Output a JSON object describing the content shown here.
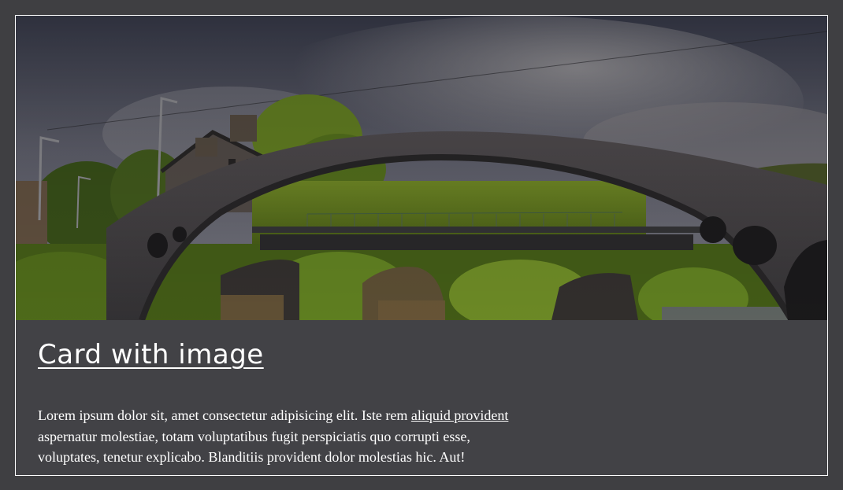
{
  "card": {
    "title": "Card with image",
    "text_before": "Lorem ipsum dolor sit, amet consectetur adipisicing elit. Iste rem ",
    "link_text": "aliquid provident",
    "text_after": " aspernatur molestiae, totam voluptatibus fugit perspiciatis quo corrupti esse, voluptates, tenetur explicabo. Blanditiis provident dolor molestias hic. Aut!",
    "image_subject": "stone arch bridge over river with trees, lamp posts and stone house under cloudy sky"
  },
  "colors": {
    "page_background": "#3f3f42",
    "card_body": "#424246",
    "card_border": "#ffffff",
    "text": "#ffffff"
  }
}
